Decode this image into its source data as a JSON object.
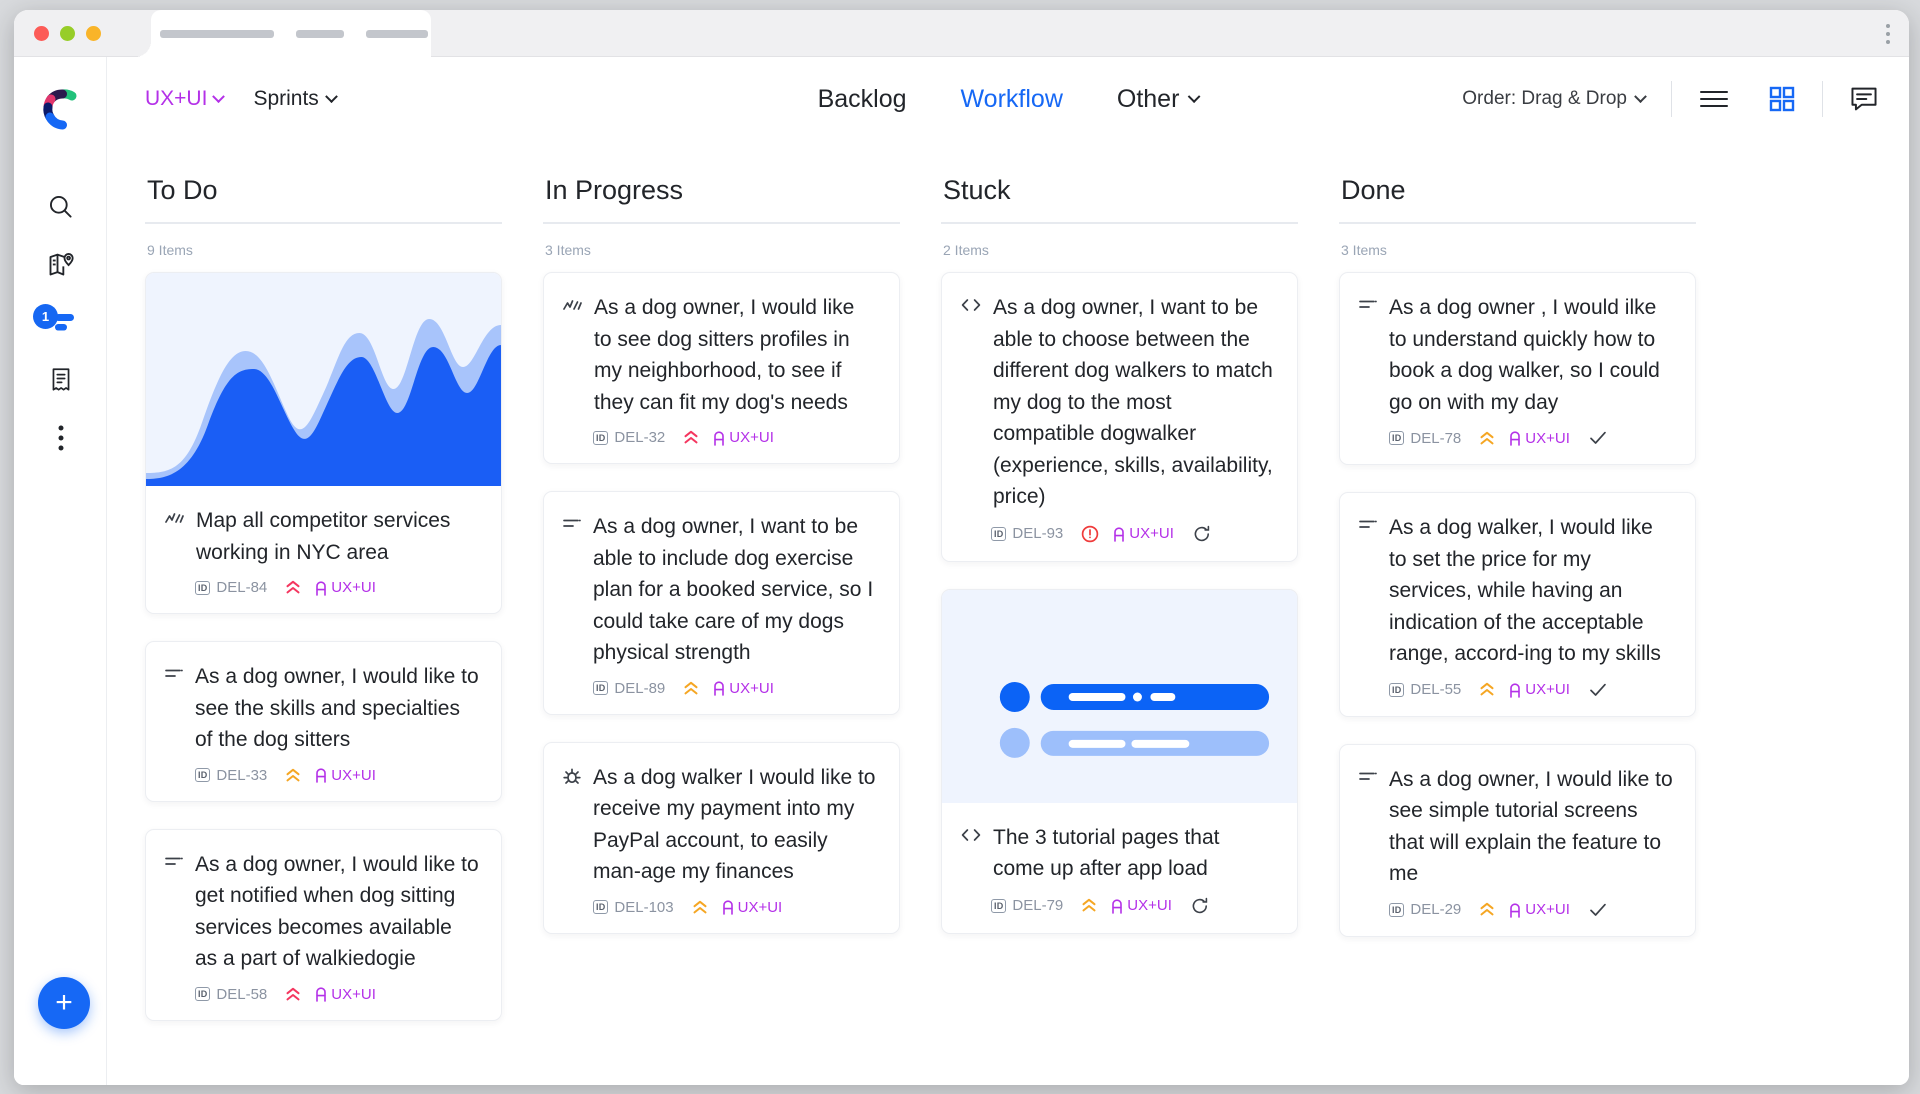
{
  "browser": {
    "tab_label": "",
    "window_menu_icon": "kebab-menu-icon"
  },
  "brand": {
    "logo_icon": "clickup-logo-icon"
  },
  "sidebar": {
    "items": [
      {
        "icon": "search-icon",
        "name": "search"
      },
      {
        "icon": "map-location-icon",
        "name": "map"
      },
      {
        "icon": "board-list-icon",
        "name": "board",
        "badge": "1",
        "active": true
      },
      {
        "icon": "document-icon",
        "name": "docs"
      },
      {
        "icon": "more-vertical-icon",
        "name": "more"
      }
    ],
    "add_button": {
      "label": "+",
      "icon": "plus-icon"
    }
  },
  "header": {
    "space_label": "UX+UI",
    "view_label": "Sprints",
    "tabs": [
      {
        "label": "Backlog",
        "active": false
      },
      {
        "label": "Workflow",
        "active": true
      },
      {
        "label": "Other",
        "active": false,
        "has_chevron": true
      }
    ],
    "order_label": "Order: Drag & Drop",
    "tools": [
      {
        "icon": "list-view-icon",
        "active": false
      },
      {
        "icon": "grid-view-icon",
        "active": true
      },
      {
        "icon": "comment-icon",
        "active": false
      }
    ]
  },
  "columns": [
    {
      "title": "To Do",
      "count_label": "9 Items",
      "cards": [
        {
          "media": "area-chart",
          "type_icon": "chart-line-icon",
          "text": "Map all competitor services working in NYC area",
          "id_badge": "ID",
          "id": "DEL-84",
          "priority": "urgent",
          "assignee": "UX+UI",
          "status_icon": null
        },
        {
          "media": null,
          "type_icon": "task-lines-icon",
          "text": "As a dog owner, I would like to see the skills and specialties of the dog sitters",
          "id_badge": "ID",
          "id": "DEL-33",
          "priority": "high",
          "assignee": "UX+UI",
          "status_icon": null
        },
        {
          "media": null,
          "type_icon": "task-lines-icon",
          "text": "As a dog owner, I would like to get notified when dog sitting services becomes available as a part of walkiedogie",
          "id_badge": "ID",
          "id": "DEL-58",
          "priority": "urgent",
          "assignee": "UX+UI",
          "status_icon": null
        }
      ]
    },
    {
      "title": "In Progress",
      "count_label": "3 Items",
      "cards": [
        {
          "media": null,
          "type_icon": "chart-line-icon",
          "text": "As a dog owner, I would like to see dog sitters profiles in my neighborhood, to see if they can fit my dog's needs",
          "id_badge": "ID",
          "id": "DEL-32",
          "priority": "urgent",
          "assignee": "UX+UI",
          "status_icon": null
        },
        {
          "media": null,
          "type_icon": "task-lines-icon",
          "text": "As a dog owner, I want to be able to include dog exercise plan for a booked service, so I could take care of my dogs physical strength",
          "id_badge": "ID",
          "id": "DEL-89",
          "priority": "high",
          "assignee": "UX+UI",
          "status_icon": null
        },
        {
          "media": null,
          "type_icon": "bug-icon",
          "text": "As a dog walker I would like to receive my payment into my PayPal account, to easily man-age my finances",
          "id_badge": "ID",
          "id": "DEL-103",
          "priority": "high",
          "assignee": "UX+UI",
          "status_icon": null
        }
      ]
    },
    {
      "title": "Stuck",
      "count_label": "2 Items",
      "cards": [
        {
          "media": null,
          "type_icon": "code-icon",
          "text": "As a dog owner, I want to be able to choose between the different dog walkers to match my dog to the most compatible dogwalker (experience, skills, availability, price)",
          "id_badge": "ID",
          "id": "DEL-93",
          "priority": "blocker",
          "assignee": "UX+UI",
          "status_icon": "refresh-icon"
        },
        {
          "media": "progress-bars",
          "type_icon": "code-icon",
          "text": "The 3 tutorial pages that come up after app load",
          "id_badge": "ID",
          "id": "DEL-79",
          "priority": "high",
          "assignee": "UX+UI",
          "status_icon": "refresh-icon"
        }
      ]
    },
    {
      "title": "Done",
      "count_label": "3 Items",
      "cards": [
        {
          "media": null,
          "type_icon": "task-lines-icon",
          "text": "As a dog owner , I would ilke to understand quickly how to book a dog walker, so I could go on with my day",
          "id_badge": "ID",
          "id": "DEL-78",
          "priority": "high",
          "assignee": "UX+UI",
          "status_icon": "check-icon"
        },
        {
          "media": null,
          "type_icon": "task-lines-icon",
          "text": "As a dog walker, I would like to set the price for my services, while having an indication of the acceptable range, accord-ing to my skills",
          "id_badge": "ID",
          "id": "DEL-55",
          "priority": "high",
          "assignee": "UX+UI",
          "status_icon": "check-icon"
        },
        {
          "media": null,
          "type_icon": "task-lines-icon",
          "text": "As a dog owner, I would like to see simple tutorial screens that will explain the feature to me",
          "id_badge": "ID",
          "id": "DEL-29",
          "priority": "high",
          "assignee": "UX+UI",
          "status_icon": "check-icon"
        }
      ]
    }
  ],
  "colors": {
    "accent_blue": "#1668f5",
    "purple": "#b431e8",
    "priority_urgent": "#f4365f",
    "priority_high": "#f5a623",
    "priority_blocker": "#ef3b3b",
    "text_dark": "#22252a",
    "muted": "#8b93a1"
  }
}
